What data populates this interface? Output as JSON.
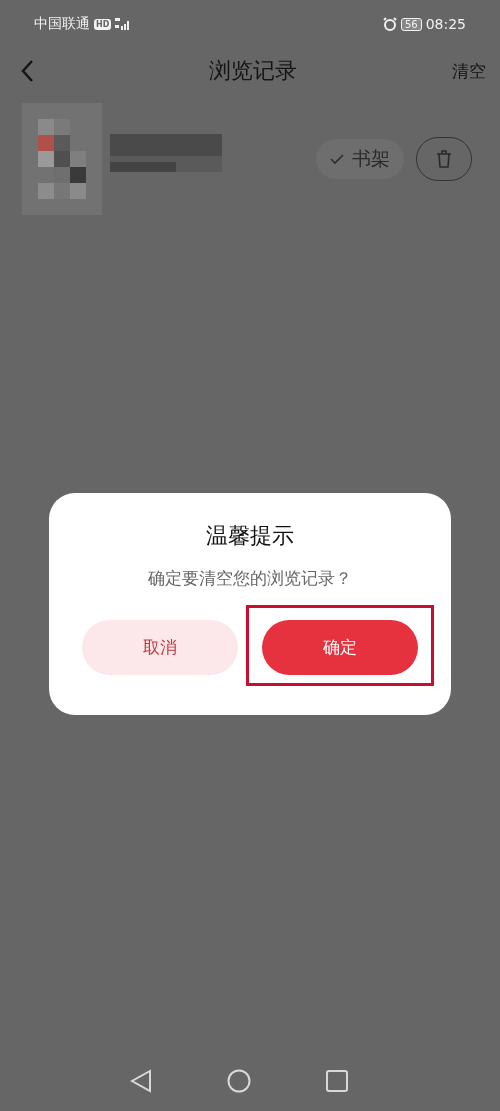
{
  "status_bar": {
    "carrier": "中国联通",
    "hd_badge": "HD",
    "battery": "56",
    "time": "08:25"
  },
  "header": {
    "title": "浏览记录",
    "action": "清空"
  },
  "history": [
    {
      "kind": "book",
      "bookshelf_label": "书架",
      "in_bookshelf": true
    }
  ],
  "dialog": {
    "title": "温馨提示",
    "message": "确定要清空您的浏览记录？",
    "buttons": [
      {
        "label": "取消",
        "kind": "secondary",
        "highlighted": false
      },
      {
        "label": "确定",
        "kind": "primary",
        "highlighted": true
      }
    ]
  }
}
